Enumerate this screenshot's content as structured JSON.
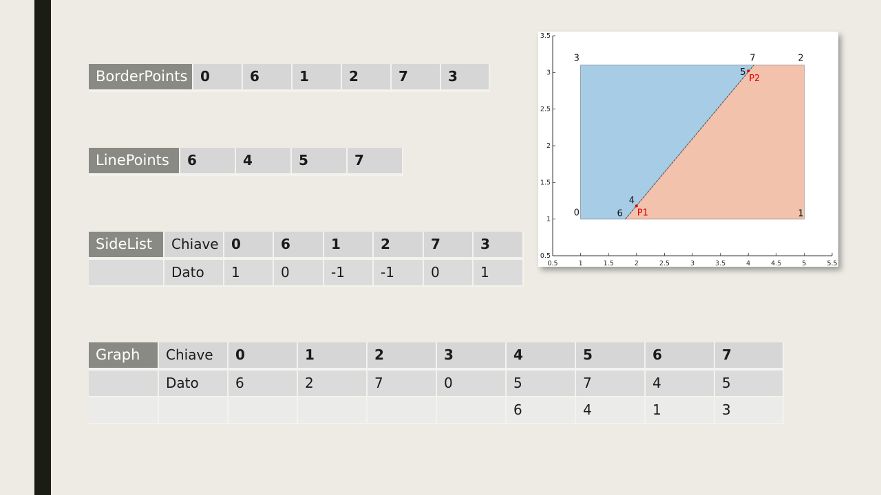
{
  "border_points": {
    "label": "BorderPoints",
    "values": [
      "0",
      "6",
      "1",
      "2",
      "7",
      "3"
    ]
  },
  "line_points": {
    "label": "LinePoints",
    "values": [
      "6",
      "4",
      "5",
      "7"
    ]
  },
  "side_list": {
    "label": "SideList",
    "key_label": "Chiave",
    "data_label": "Dato",
    "keys": [
      "0",
      "6",
      "1",
      "2",
      "7",
      "3"
    ],
    "data": [
      "1",
      "0",
      "-1",
      "-1",
      "0",
      "1"
    ]
  },
  "graph": {
    "label": "Graph",
    "key_label": "Chiave",
    "data_label": "Dato",
    "keys": [
      "0",
      "1",
      "2",
      "3",
      "4",
      "5",
      "6",
      "7"
    ],
    "data_row1": [
      "6",
      "2",
      "7",
      "0",
      "5",
      "7",
      "4",
      "5"
    ],
    "data_row2": [
      "",
      "",
      "",
      "",
      "6",
      "4",
      "1",
      "3"
    ]
  },
  "chart_data": {
    "type": "area",
    "xlim": [
      0.5,
      5.5
    ],
    "ylim": [
      0.5,
      3.5
    ],
    "xticks": [
      "0.5",
      "1",
      "1.5",
      "2",
      "2.5",
      "3",
      "3.5",
      "4",
      "4.5",
      "5",
      "5.5"
    ],
    "yticks": [
      "0.5",
      "1",
      "1.5",
      "2",
      "2.5",
      "3",
      "3.5"
    ],
    "grid": false,
    "colors": {
      "left_region": "#a6cce6",
      "right_region": "#f2c2ad",
      "highlight": "#e00000"
    },
    "left_region": [
      [
        1,
        1
      ],
      [
        1.8,
        1
      ],
      [
        4.1,
        3.1
      ],
      [
        1,
        3.1
      ]
    ],
    "right_region": [
      [
        1.8,
        1
      ],
      [
        5,
        1
      ],
      [
        5,
        3.1
      ],
      [
        4.1,
        3.1
      ]
    ],
    "points": [
      {
        "label": "0",
        "x": 1,
        "y": 1
      },
      {
        "label": "1",
        "x": 5,
        "y": 1
      },
      {
        "label": "2",
        "x": 5,
        "y": 3.1
      },
      {
        "label": "3",
        "x": 1,
        "y": 3.1
      },
      {
        "label": "4",
        "x": 2.0,
        "y": 1.18
      },
      {
        "label": "5",
        "x": 4.0,
        "y": 3.02
      },
      {
        "label": "6",
        "x": 1.8,
        "y": 1
      },
      {
        "label": "7",
        "x": 4.1,
        "y": 3.1
      }
    ],
    "annotations": [
      {
        "label": "P1",
        "x": 2.0,
        "y": 1.18
      },
      {
        "label": "P2",
        "x": 4.0,
        "y": 3.02
      }
    ]
  }
}
